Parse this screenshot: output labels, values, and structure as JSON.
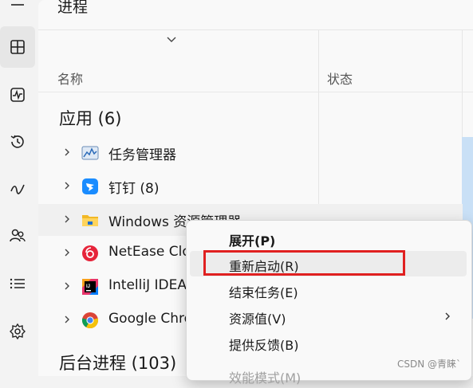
{
  "page": {
    "title": "进程"
  },
  "columns": {
    "name": "名称",
    "status": "状态"
  },
  "sections": {
    "apps": "应用 (6)",
    "background": "后台进程 (103)"
  },
  "apps": [
    {
      "name": "任务管理器",
      "icon": "task-manager-icon"
    },
    {
      "name": "钉钉 (8)",
      "icon": "dingtalk-icon"
    },
    {
      "name": "Windows 资源管理器",
      "icon": "folder-icon"
    },
    {
      "name": "NetEase Cloud Music",
      "icon": "netease-music-icon"
    },
    {
      "name": "IntelliJ IDEA",
      "icon": "intellij-icon"
    },
    {
      "name": "Google Chrome",
      "icon": "chrome-icon"
    }
  ],
  "context_menu": {
    "expand": "展开(P)",
    "restart": "重新启动(R)",
    "end_task": "结束任务(E)",
    "resource_values": "资源值(V)",
    "feedback": "提供反馈(B)",
    "efficiency": "效能模式(M)"
  },
  "nav_icons": [
    "menu-icon",
    "processes-icon",
    "performance-icon",
    "app-history-icon",
    "startup-apps-icon",
    "users-icon",
    "details-icon",
    "services-icon"
  ],
  "watermark": "CSDN @青睐`",
  "colors": {
    "highlight_box": "#e02020",
    "accent_strip": "#c9e0f6"
  }
}
